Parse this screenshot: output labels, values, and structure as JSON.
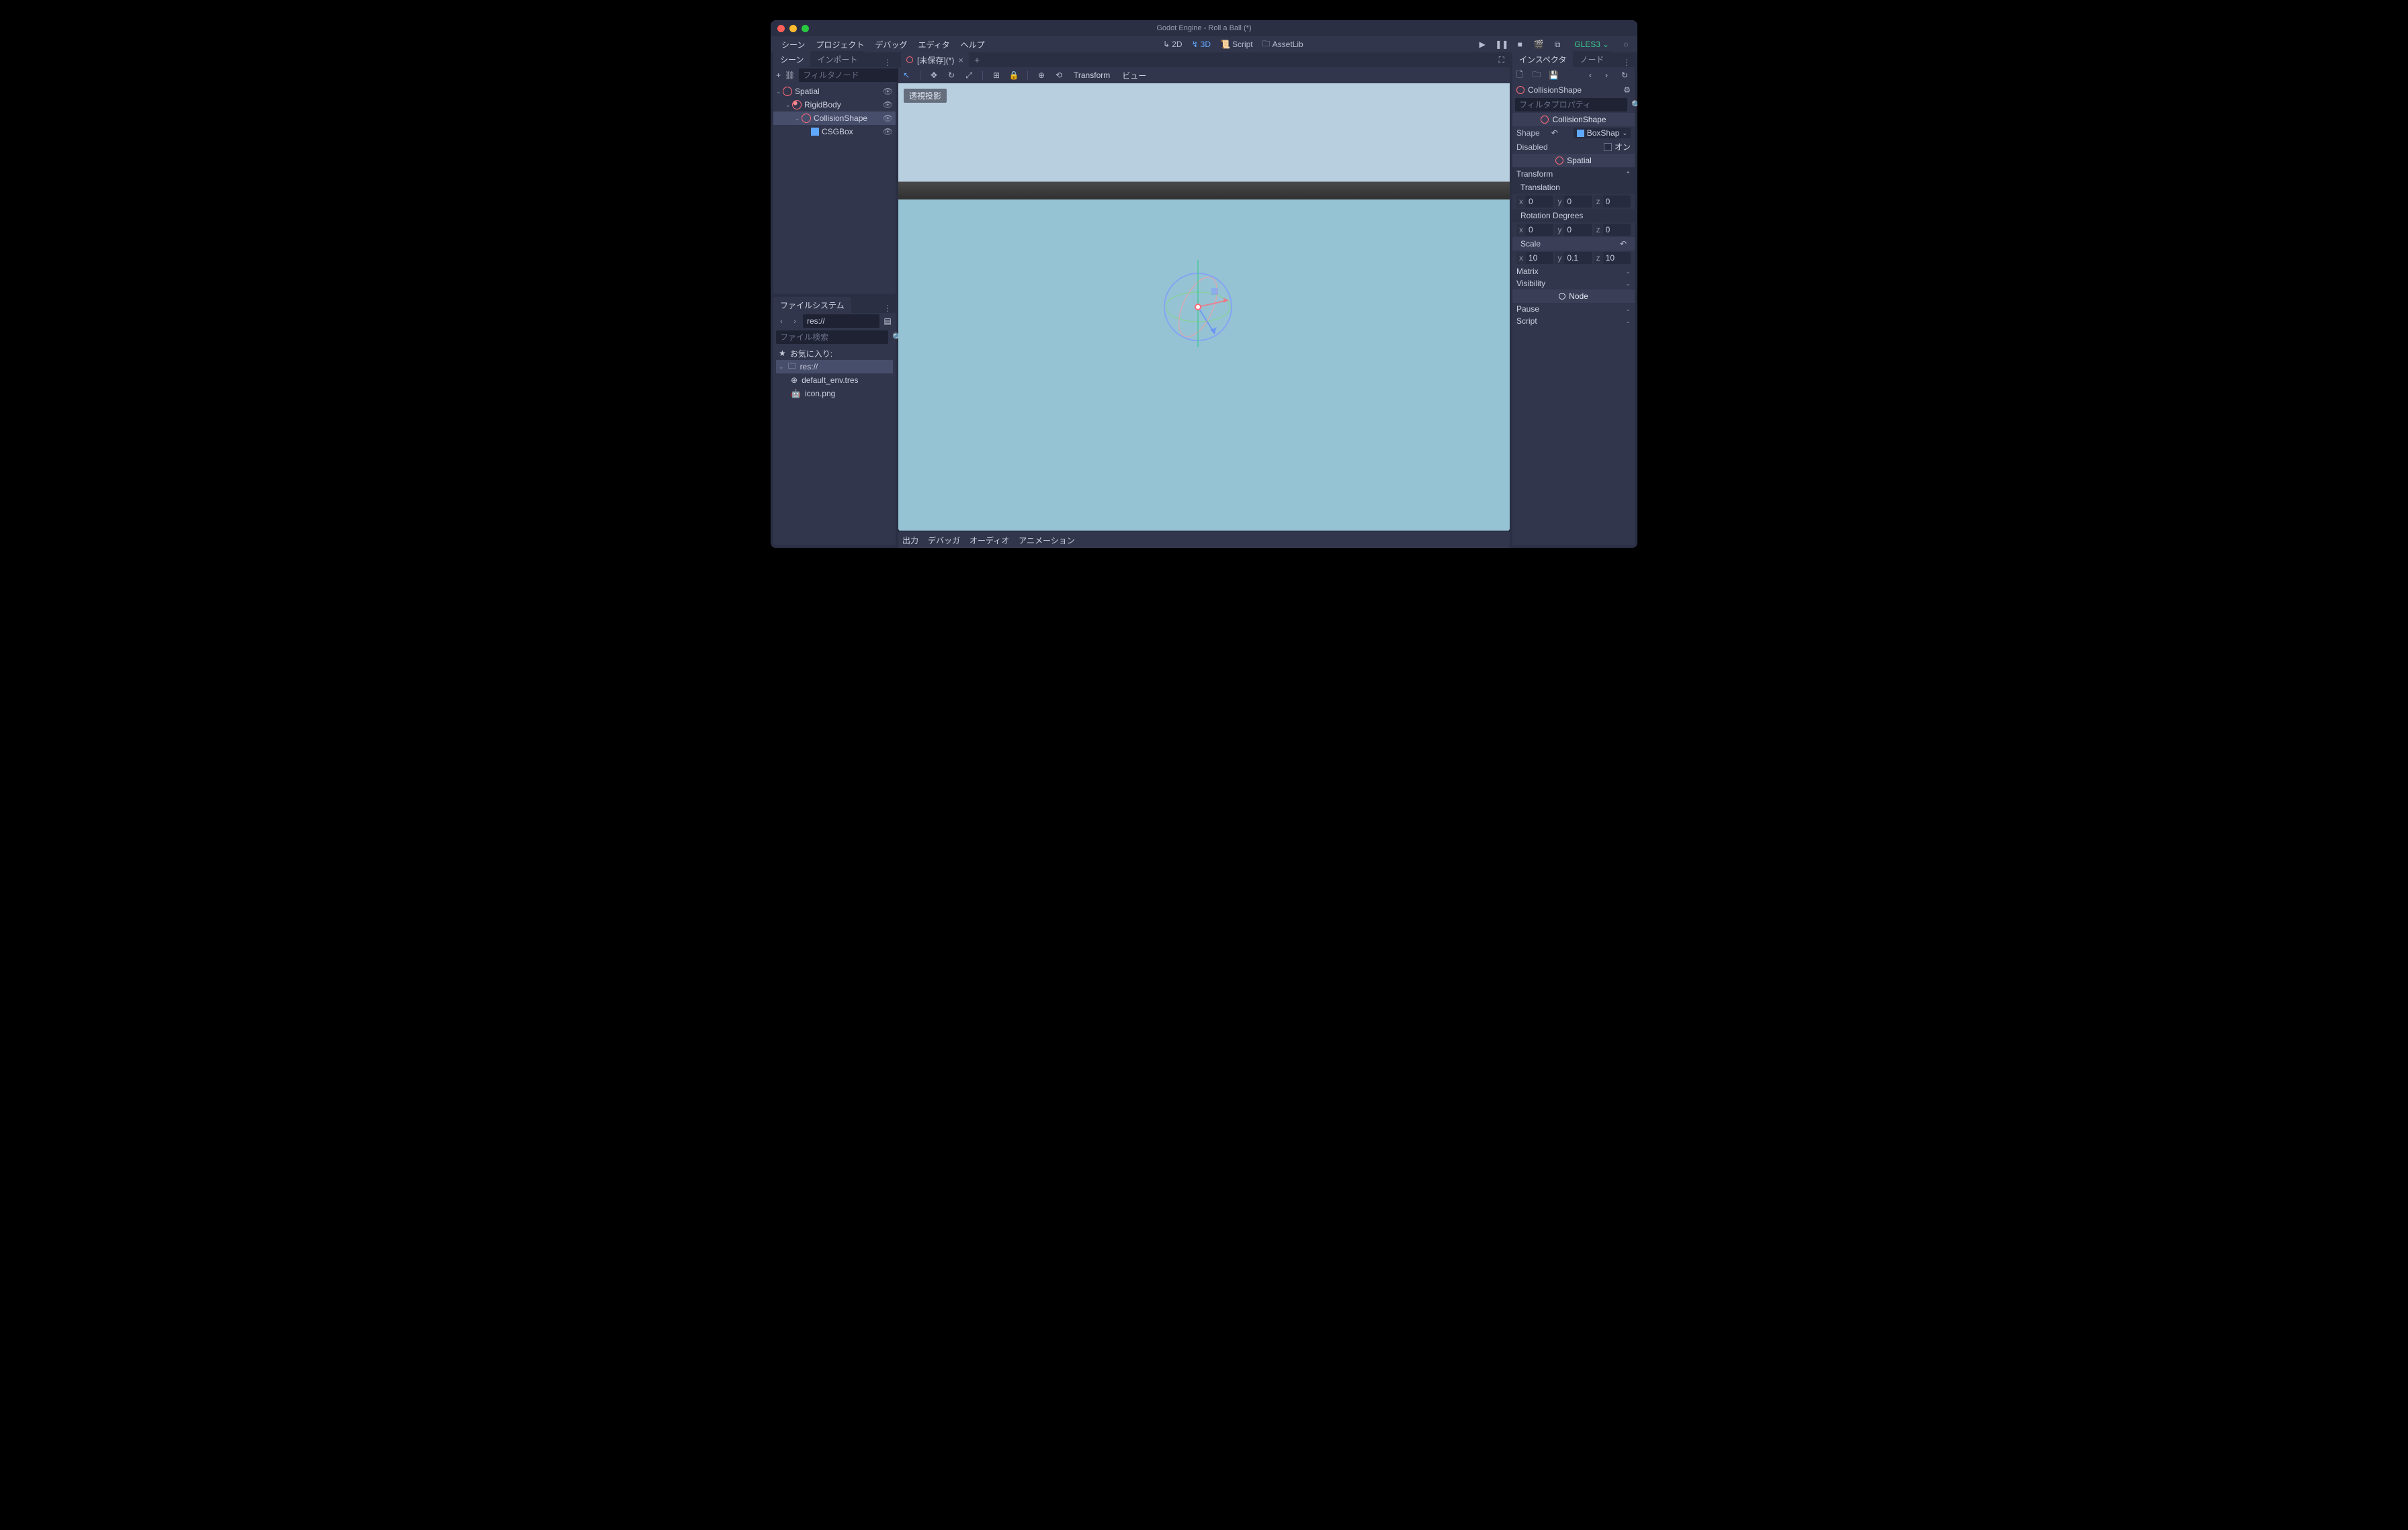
{
  "titlebar": {
    "title": "Godot Engine - Roll a Ball (*)"
  },
  "menubar": {
    "items": [
      "シーン",
      "プロジェクト",
      "デバッグ",
      "エディタ",
      "ヘルプ"
    ],
    "modes": {
      "d2": "2D",
      "d3": "3D",
      "script": "Script",
      "assetlib": "AssetLib"
    },
    "renderer": "GLES3"
  },
  "leftTabs": {
    "scene": "シーン",
    "import": "インポート"
  },
  "sceneTree": {
    "filterPlaceholder": "フィルタノード",
    "nodes": {
      "spatial": "Spatial",
      "rigidbody": "RigidBody",
      "collisionshape": "CollisionShape",
      "csgbox": "CSGBox"
    }
  },
  "fileSystem": {
    "title": "ファイルシステム",
    "path": "res://",
    "searchPlaceholder": "ファイル検索",
    "favorites": "お気に入り:",
    "root": "res://",
    "files": {
      "env": "default_env.tres",
      "icon": "icon.png"
    }
  },
  "sceneTab": {
    "name": "[未保存](*)"
  },
  "viewportBar": {
    "transform": "Transform",
    "view": "ビュー"
  },
  "viewport": {
    "projection": "透視投影"
  },
  "bottomTabs": {
    "output": "出力",
    "debugger": "デバッガ",
    "audio": "オーディオ",
    "animation": "アニメーション"
  },
  "rightTabs": {
    "inspector": "インスペクタ",
    "node": "ノード"
  },
  "inspector": {
    "objectName": "CollisionShape",
    "filterPlaceholder": "フィルタプロパティ",
    "sectionCollision": "CollisionShape",
    "shapeLabel": "Shape",
    "shapeValue": "BoxShap",
    "disabledLabel": "Disabled",
    "disabledValue": "オン",
    "sectionSpatial": "Spatial",
    "transformLabel": "Transform",
    "translation": {
      "label": "Translation",
      "x": "0",
      "y": "0",
      "z": "0"
    },
    "rotation": {
      "label": "Rotation Degrees",
      "x": "0",
      "y": "0",
      "z": "0"
    },
    "scale": {
      "label": "Scale",
      "x": "10",
      "y": "0.1",
      "z": "10"
    },
    "matrix": "Matrix",
    "visibility": "Visibility",
    "sectionNode": "Node",
    "pause": "Pause",
    "script": "Script"
  }
}
